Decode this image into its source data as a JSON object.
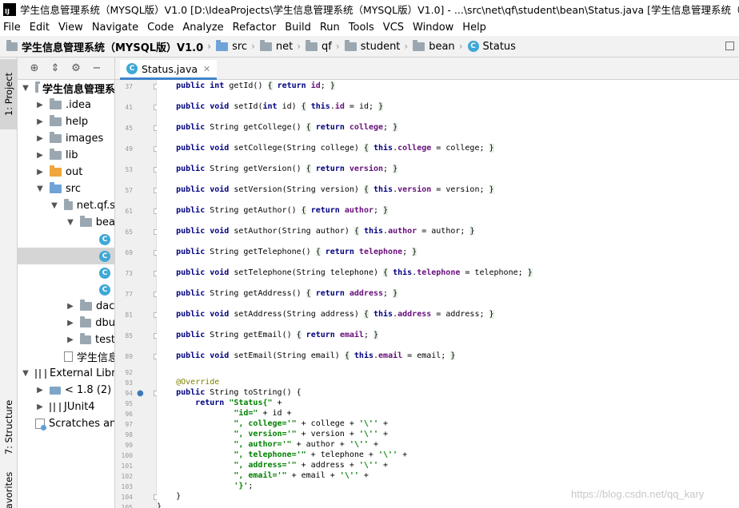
{
  "window": {
    "title": "学生信息管理系统（MYSQL版）V1.0 [D:\\IdeaProjects\\学生信息管理系统（MYSQL版）V1.0] - ...\\src\\net\\qf\\student\\bean\\Status.java [学生信息管理系统（MYSQL版）"
  },
  "menu": [
    "File",
    "Edit",
    "View",
    "Navigate",
    "Code",
    "Analyze",
    "Refactor",
    "Build",
    "Run",
    "Tools",
    "VCS",
    "Window",
    "Help"
  ],
  "breadcrumb": {
    "project": "学生信息管理系统（MYSQL版）V1.0",
    "items": [
      "src",
      "net",
      "qf",
      "student",
      "bean",
      "Status"
    ]
  },
  "tool_windows": {
    "project": "1: Project",
    "structure": "7: Structure",
    "favorites": "avorites"
  },
  "tree": {
    "root": "学生信息管理系",
    "idea": ".idea",
    "help": "help",
    "images": "images",
    "lib": "lib",
    "out": "out",
    "src": "src",
    "net_pkg": "net.qf.s",
    "bean": "bea",
    "c1": "c",
    "dao": "dac",
    "dbu": "dbu",
    "test": "test",
    "iml": "学生信息管",
    "external": "External Librar",
    "jdk": "< 1.8 (2) >",
    "junit": "JUnit4",
    "scratches": "Scratches and"
  },
  "editor": {
    "tab_label": "Status.java",
    "lines": [
      {
        "n": "37",
        "code": "    public int getId() { return id; }"
      },
      {
        "n": "41",
        "code": "    public void setId(int id) { this.id = id; }"
      },
      {
        "n": "45",
        "code": "    public String getCollege() { return college; }"
      },
      {
        "n": "49",
        "code": "    public void setCollege(String college) { this.college = college; }"
      },
      {
        "n": "53",
        "code": "    public String getVersion() { return version; }"
      },
      {
        "n": "57",
        "code": "    public void setVersion(String version) { this.version = version; }"
      },
      {
        "n": "61",
        "code": "    public String getAuthor() { return author; }"
      },
      {
        "n": "65",
        "code": "    public void setAuthor(String author) { this.author = author; }"
      },
      {
        "n": "69",
        "code": "    public String getTelephone() { return telephone; }"
      },
      {
        "n": "73",
        "code": "    public void setTelephone(String telephone) { this.telephone = telephone; }"
      },
      {
        "n": "77",
        "code": "    public String getAddress() { return address; }"
      },
      {
        "n": "81",
        "code": "    public void setAddress(String address) { this.address = address; }"
      },
      {
        "n": "85",
        "code": "    public String getEmail() { return email; }"
      },
      {
        "n": "89",
        "code": "    public void setEmail(String email) { this.email = email; }"
      }
    ],
    "tail": [
      {
        "n": "92",
        "code": ""
      },
      {
        "n": "93",
        "code": "    @Override"
      },
      {
        "n": "94",
        "code": "    public String toString() {"
      },
      {
        "n": "95",
        "code": "        return \"Status{\" +"
      },
      {
        "n": "96",
        "code": "                \"id=\" + id +"
      },
      {
        "n": "97",
        "code": "                \", college='\" + college + '\\'' +"
      },
      {
        "n": "98",
        "code": "                \", version='\" + version + '\\'' +"
      },
      {
        "n": "99",
        "code": "                \", author='\" + author + '\\'' +"
      },
      {
        "n": "100",
        "code": "                \", telephone='\" + telephone + '\\'' +"
      },
      {
        "n": "101",
        "code": "                \", address='\" + address + '\\'' +"
      },
      {
        "n": "102",
        "code": "                \", email='\" + email + '\\'' +"
      },
      {
        "n": "103",
        "code": "                '}';"
      },
      {
        "n": "104",
        "code": "    }"
      },
      {
        "n": "105",
        "code": "}"
      }
    ]
  },
  "watermark": "https://blog.csdn.net/qq_kary"
}
